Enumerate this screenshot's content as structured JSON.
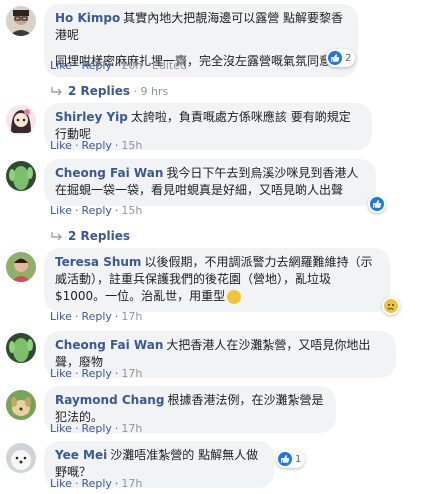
{
  "comments": [
    {
      "name": "Ho Kimpo",
      "text": "其實內地大把靚海邊可以露營 點解要黎香港呢",
      "text2": "同埋咁樣密麻麻扎埋一齊，完全沒左露營嘅氣氛同意義",
      "like": "Like",
      "reply": "Reply",
      "time": "20h",
      "edited": "Edited",
      "reactions": "2",
      "avatar_icon": "person-glasses-avatar"
    },
    {
      "name": "Shirley Yip",
      "text": "太誇啦，負責嘅處方係咪應該 要有啲規定行動呢",
      "like": "Like",
      "reply": "Reply",
      "time": "15h",
      "avatar_icon": "anime-girl-avatar"
    },
    {
      "name": "Cheong Fai Wan",
      "text": "我今日下午去到烏溪沙咪見到香港人在掘蜆一袋一袋，看見咁蜆真是好細，又唔見啲人出聲",
      "like": "Like",
      "reply": "Reply",
      "time": "15h",
      "reactions": "",
      "avatar_icon": "cactus-avatar"
    },
    {
      "name": "Teresa Shum",
      "text": "以後假期，不用調派警力去網羅難維持（示威活動），註重兵保護我們的後花園（營地），亂垃圾$1000。一位。治亂世，用重型",
      "like": "Like",
      "reply": "Reply",
      "time": "17h",
      "avatar_icon": "child-photo-avatar"
    },
    {
      "name": "Cheong Fai Wan",
      "text": "大把香港人在沙灘紮營，又唔見你地出聲，廢物",
      "like": "Like",
      "reply": "Reply",
      "time": "17h",
      "avatar_icon": "cactus-avatar"
    },
    {
      "name": "Raymond Chang",
      "text": "根據香港法例，在沙灘紮營是犯法的。",
      "like": "Like",
      "reply": "Reply",
      "time": "17h",
      "avatar_icon": "dog-photo-avatar"
    },
    {
      "name": "Yee Mei",
      "text": "沙灘唔准紮營的 點解無人做野嘅？",
      "like": "Like",
      "reply": "Reply",
      "time": "17h",
      "reactions": "1",
      "avatar_icon": "white-dog-avatar"
    }
  ],
  "replies_1": {
    "label": "2 Replies",
    "time": "9 hrs"
  },
  "replies_3": {
    "label": "2 Replies"
  },
  "colors": {
    "link": "#385898",
    "bubble": "#f2f3f5",
    "like_blue": "#1877f2",
    "sad_yellow": "#f5c33b"
  }
}
